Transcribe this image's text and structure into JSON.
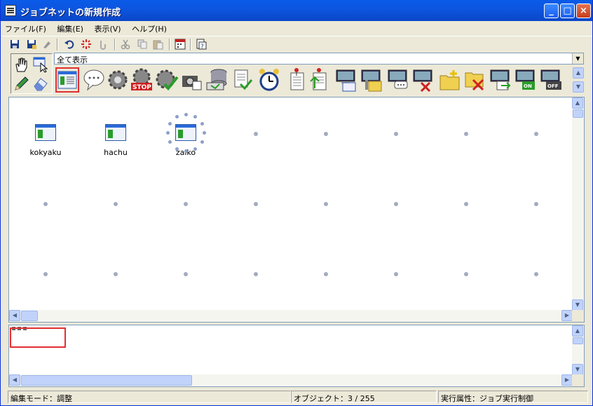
{
  "window": {
    "title": "ジョブネットの新規作成",
    "controls": [
      "_",
      "□",
      "×"
    ]
  },
  "menu": [
    {
      "label": "ファイル(F)"
    },
    {
      "label": "編集(E)"
    },
    {
      "label": "表示(V)"
    },
    {
      "label": "ヘルプ(H)"
    }
  ],
  "filter": {
    "value": "全て表示"
  },
  "jobs": [
    {
      "name": "kokyaku"
    },
    {
      "name": "hachu"
    },
    {
      "name": "zaiko"
    }
  ],
  "status": {
    "mode": "編集モード：調整",
    "objects": "オブジェクト：3 / 255",
    "attr": "実行属性：ジョブ実行制御"
  },
  "palette_icons": [
    "job-icon",
    "message-icon",
    "gear-icon",
    "stop-gear-icon",
    "check-gear-icon",
    "camera-icon",
    "database-icon",
    "file-check-icon",
    "alarm-clock-icon",
    "document-flag-icon",
    "document-upload-icon",
    "pc-icon",
    "pc-folder-icon",
    "pc-message-icon",
    "pc-delete-icon",
    "folder-add-icon",
    "folder-delete-icon",
    "pc-transfer-icon",
    "pc-on-icon",
    "pc-off-icon"
  ],
  "colors": {
    "titlebar": "#0a5be9",
    "selection": "#e03030",
    "grid_dot": "#a3abc0"
  }
}
